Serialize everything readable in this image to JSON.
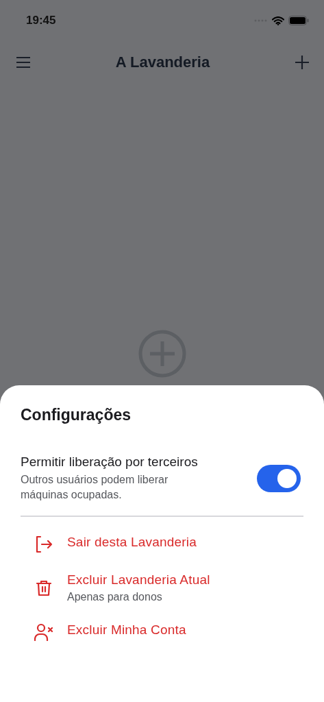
{
  "status_bar": {
    "time": "19:45"
  },
  "header": {
    "title": "A Lavanderia"
  },
  "sheet": {
    "title": "Configurações",
    "setting": {
      "label": "Permitir liberação por terceiros",
      "description": "Outros usuários podem liberar máquinas ocupadas.",
      "on": true
    },
    "actions": [
      {
        "kind": "leave",
        "label": "Sair desta Lavanderia"
      },
      {
        "kind": "delete",
        "label": "Excluir Lavanderia Atual",
        "subtitle": "Apenas para donos"
      },
      {
        "kind": "account",
        "label": "Excluir Minha Conta"
      }
    ]
  }
}
